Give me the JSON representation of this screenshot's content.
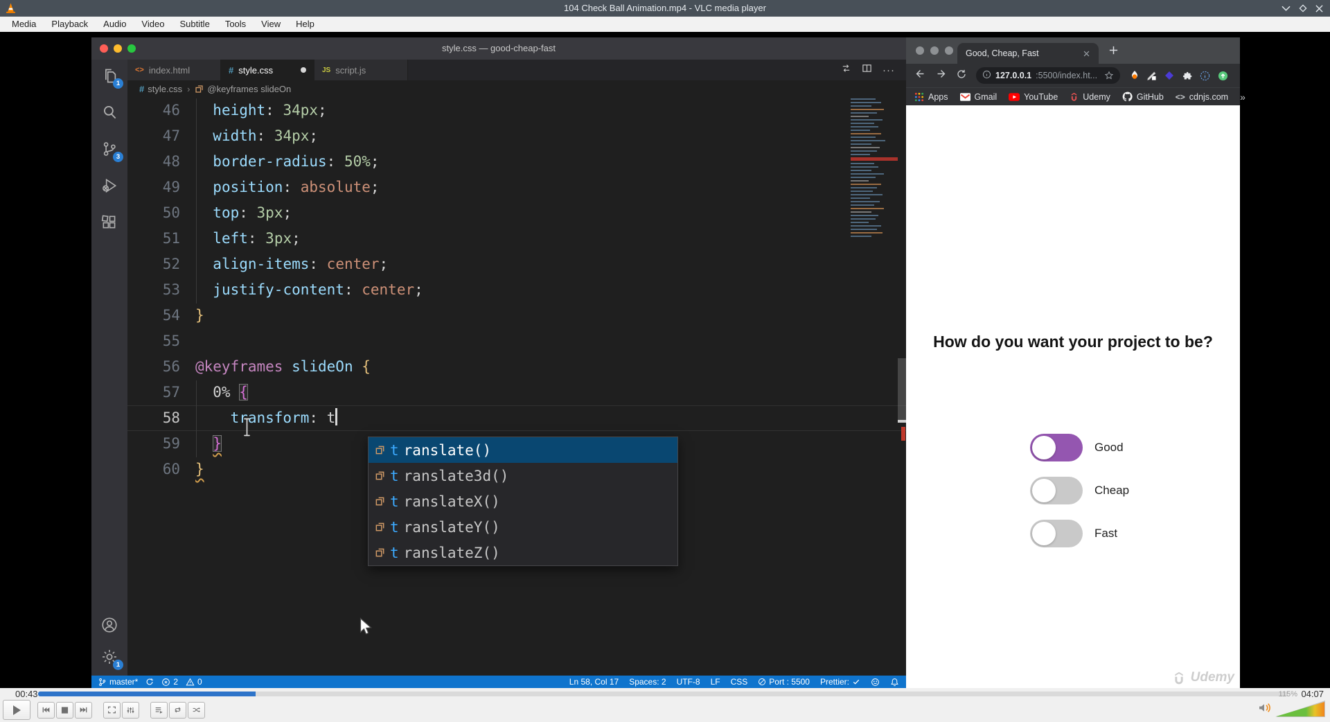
{
  "vlc": {
    "app_title": "104 Check Ball Animation.mp4 - VLC media player",
    "menu_items": [
      "Media",
      "Playback",
      "Audio",
      "Video",
      "Subtitle",
      "Tools",
      "View",
      "Help"
    ],
    "elapsed_time": "00:43",
    "total_time": "04:07",
    "progress_percent": 17.4,
    "volume_label": "115%",
    "controls": [
      "previous",
      "stop",
      "next",
      "fullscreen",
      "equalizer",
      "playlist",
      "loop",
      "shuffle"
    ]
  },
  "vscode": {
    "window_title": "style.css — good-cheap-fast",
    "activity_bar": [
      {
        "name": "explorer",
        "badge": "1"
      },
      {
        "name": "search"
      },
      {
        "name": "source-control",
        "badge": "3"
      },
      {
        "name": "run-debug"
      },
      {
        "name": "extensions"
      }
    ],
    "activity_bottom": [
      {
        "name": "account"
      },
      {
        "name": "settings",
        "badge": "1"
      }
    ],
    "tabs": [
      {
        "label": "index.html",
        "icon": "html",
        "active": false,
        "dirty": false
      },
      {
        "label": "style.css",
        "icon": "css",
        "active": true,
        "dirty": true
      },
      {
        "label": "script.js",
        "icon": "js",
        "active": false,
        "dirty": false
      }
    ],
    "breadcrumb": [
      {
        "icon": "css",
        "label": "style.css"
      },
      {
        "icon": "keyframes",
        "label": "@keyframes slideOn"
      }
    ],
    "code_lines": [
      {
        "n": "46",
        "tk": [
          [
            "pu",
            "  "
          ],
          [
            "pr",
            "height"
          ],
          [
            "pu",
            ": "
          ],
          [
            "nu",
            "34px"
          ],
          [
            "pu",
            ";"
          ]
        ]
      },
      {
        "n": "47",
        "tk": [
          [
            "pu",
            "  "
          ],
          [
            "pr",
            "width"
          ],
          [
            "pu",
            ": "
          ],
          [
            "nu",
            "34px"
          ],
          [
            "pu",
            ";"
          ]
        ]
      },
      {
        "n": "48",
        "tk": [
          [
            "pu",
            "  "
          ],
          [
            "pr",
            "border-radius"
          ],
          [
            "pu",
            ": "
          ],
          [
            "nu",
            "50%"
          ],
          [
            "pu",
            ";"
          ]
        ]
      },
      {
        "n": "49",
        "tk": [
          [
            "pu",
            "  "
          ],
          [
            "pr",
            "position"
          ],
          [
            "pu",
            ": "
          ],
          [
            "kw",
            "absolute"
          ],
          [
            "pu",
            ";"
          ]
        ]
      },
      {
        "n": "50",
        "tk": [
          [
            "pu",
            "  "
          ],
          [
            "pr",
            "top"
          ],
          [
            "pu",
            ": "
          ],
          [
            "nu",
            "3px"
          ],
          [
            "pu",
            ";"
          ]
        ]
      },
      {
        "n": "51",
        "tk": [
          [
            "pu",
            "  "
          ],
          [
            "pr",
            "left"
          ],
          [
            "pu",
            ": "
          ],
          [
            "nu",
            "3px"
          ],
          [
            "pu",
            ";"
          ]
        ]
      },
      {
        "n": "52",
        "tk": [
          [
            "pu",
            "  "
          ],
          [
            "pr",
            "align-items"
          ],
          [
            "pu",
            ": "
          ],
          [
            "kw",
            "center"
          ],
          [
            "pu",
            ";"
          ]
        ]
      },
      {
        "n": "53",
        "tk": [
          [
            "pu",
            "  "
          ],
          [
            "pr",
            "justify-content"
          ],
          [
            "pu",
            ": "
          ],
          [
            "kw",
            "center"
          ],
          [
            "pu",
            ";"
          ]
        ]
      },
      {
        "n": "54",
        "tk": [
          [
            "by",
            "}"
          ]
        ]
      },
      {
        "n": "55",
        "tk": []
      },
      {
        "n": "56",
        "tk": [
          [
            "at",
            "@keyframes"
          ],
          [
            "pu",
            " "
          ],
          [
            "pr",
            "slideOn"
          ],
          [
            "pu",
            " "
          ],
          [
            "by",
            "{"
          ]
        ]
      },
      {
        "n": "57",
        "tk": [
          [
            "pu",
            "  0% "
          ],
          [
            "bp m",
            "{"
          ]
        ]
      },
      {
        "n": "58",
        "tk": [
          [
            "pu",
            "    "
          ],
          [
            "pr",
            "transform"
          ],
          [
            "pu",
            ": t"
          ]
        ],
        "caret": true,
        "cur": true
      },
      {
        "n": "59",
        "tk": [
          [
            "pu",
            "  "
          ],
          [
            "bp m sq",
            "}"
          ]
        ]
      },
      {
        "n": "60",
        "tk": [
          [
            "by sq",
            "}"
          ]
        ]
      }
    ],
    "suggest": {
      "prefix": "t",
      "selected_index": 0,
      "items": [
        "translate()",
        "translate3d()",
        "translateX()",
        "translateY()",
        "translateZ()"
      ]
    },
    "status_left": [
      {
        "icon": "branch",
        "label": "master*"
      },
      {
        "icon": "sync",
        "label": ""
      },
      {
        "icon": "error",
        "label": "2"
      },
      {
        "icon": "warning",
        "label": "0"
      }
    ],
    "status_right": [
      {
        "label": "Ln 58, Col 17"
      },
      {
        "label": "Spaces: 2"
      },
      {
        "label": "UTF-8"
      },
      {
        "label": "LF"
      },
      {
        "label": "CSS"
      },
      {
        "icon": "port",
        "label": "Port : 5500"
      },
      {
        "label": "Prettier:",
        "icon_after": "check"
      },
      {
        "icon": "feedback",
        "label": ""
      },
      {
        "icon": "bell",
        "label": ""
      }
    ]
  },
  "browser": {
    "tab_title": "Good, Cheap, Fast",
    "url": {
      "host": "127.0.0.1",
      "rest": ":5500/index.ht..."
    },
    "bookmarks": [
      {
        "icon": "apps",
        "label": "Apps"
      },
      {
        "icon": "gmail",
        "label": "Gmail"
      },
      {
        "icon": "youtube",
        "label": "YouTube"
      },
      {
        "icon": "udemy",
        "label": "Udemy"
      },
      {
        "icon": "github",
        "label": "GitHub"
      },
      {
        "icon": "code",
        "label": "cdnjs.com"
      }
    ],
    "bookmarks_overflow": "»",
    "page": {
      "heading": "How do you want your project to be?",
      "accent_color": "#9456b0",
      "toggles": [
        {
          "label": "Good",
          "on": true
        },
        {
          "label": "Cheap",
          "on": false
        },
        {
          "label": "Fast",
          "on": false
        }
      ]
    },
    "watermark": "Udemy"
  }
}
